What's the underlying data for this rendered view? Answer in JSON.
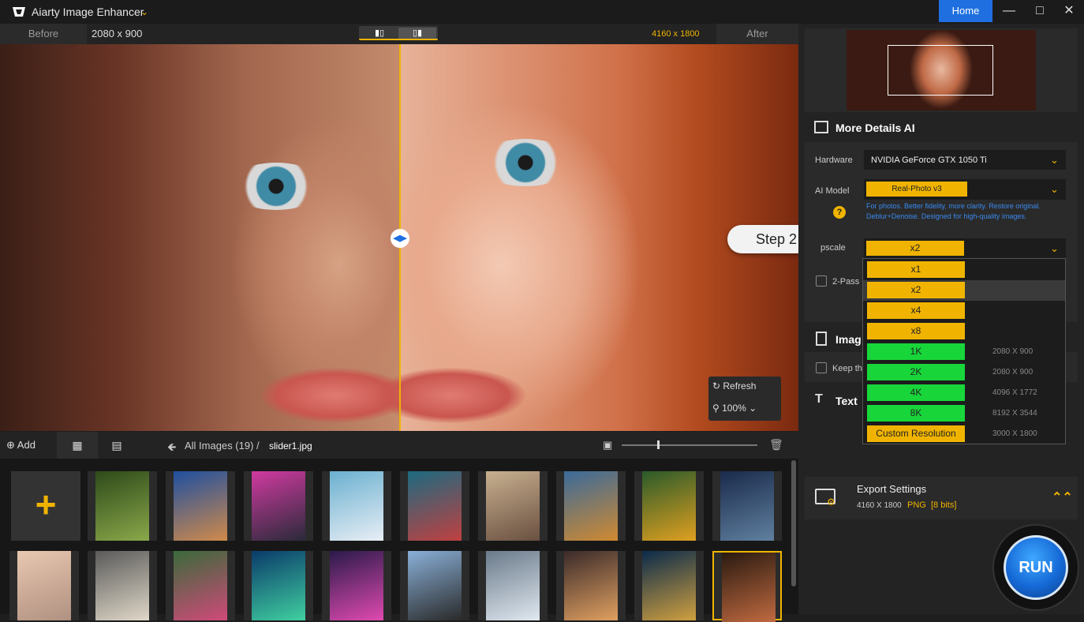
{
  "app": {
    "title": "Aiarty Image Enhancer",
    "home_label": "Home",
    "min_icon": "minimize-icon",
    "max_icon": "maximize-icon",
    "close_icon": "close-icon"
  },
  "compare": {
    "before_label": "Before",
    "before_res": "2080 x 900",
    "after_res": "4160 x 1800",
    "after_label": "After"
  },
  "preview": {
    "refresh_label": "Refresh",
    "zoom_value": "100%"
  },
  "tutorial": {
    "step_label": "Step 2"
  },
  "gallery": {
    "add_label": "Add",
    "breadcrumb_all": "All Images (19)",
    "breadcrumb_sep": "/",
    "current_file": "slider1.jpg",
    "zoom_level": 0.26
  },
  "panel": {
    "ai_section_title": "More Details AI",
    "hardware_label": "Hardware",
    "hardware_value": "NVIDIA GeForce GTX 1050 Ti",
    "ai_model_label": "AI Model",
    "ai_model_value": "Real-Photo v3",
    "ai_model_desc": "For photos. Better fidelity, more clarity. Restore original. Deblur+Denoise. Designed for high-quality images.",
    "upscale_label": "pscale",
    "upscale_value": "x2",
    "two_pass_label": "2-Pass",
    "image_section_title": "Imag",
    "keep_label": "Keep th",
    "text_section_title": "Text",
    "upscale_options": [
      {
        "label": "x1",
        "res": ""
      },
      {
        "label": "x2",
        "res": ""
      },
      {
        "label": "x4",
        "res": ""
      },
      {
        "label": "x8",
        "res": ""
      },
      {
        "label": "1K",
        "res": "2080 X 900"
      },
      {
        "label": "2K",
        "res": "2080 X 900"
      },
      {
        "label": "4K",
        "res": "4096 X 1772"
      },
      {
        "label": "8K",
        "res": "8192 X 3544"
      },
      {
        "label": "Custom Resolution",
        "res": "3000 X 1800"
      }
    ]
  },
  "export": {
    "title": "Export Settings",
    "res": "4160 X 1800",
    "format": "PNG",
    "bits": "[8 bits]"
  },
  "run_label": "RUN",
  "colors": {
    "accent": "#f0b400",
    "home_blue": "#1f6fe0",
    "resolution_green": "#18d63a"
  }
}
